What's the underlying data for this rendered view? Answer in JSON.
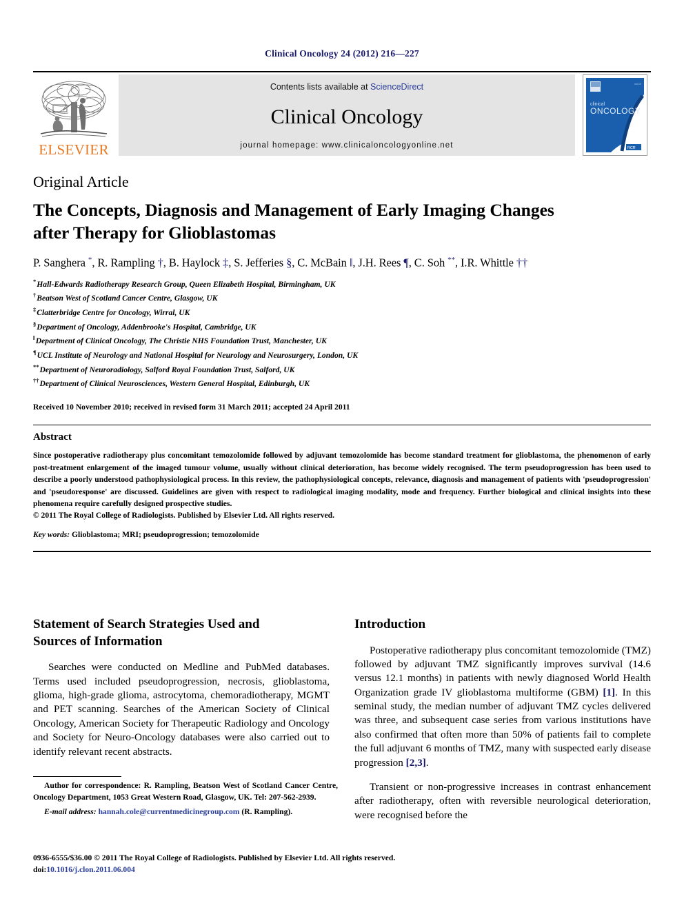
{
  "running_head": "Clinical Oncology 24 (2012) 216—227",
  "masthead": {
    "publisher_name": "ELSEVIER",
    "contents_prefix": "Contents lists available at ",
    "contents_link": "ScienceDirect",
    "journal_name": "Clinical Oncology",
    "homepage": "journal homepage: www.clinicaloncologyonline.net",
    "cover": {
      "line1": "clinical",
      "line2": "ONCOLOGY",
      "badge": "RCR"
    },
    "colors": {
      "elsevier_orange": "#E87722",
      "link_blue": "#2b3f9e",
      "band_grey": "#e4e4e4",
      "cover_blue": "#1a5fae"
    }
  },
  "article": {
    "type": "Original Article",
    "title_line1": "The Concepts, Diagnosis and Management of Early Imaging Changes",
    "title_line2": "after Therapy for Glioblastomas",
    "authors_html": "P. Sanghera <sup>*</sup>, R. Rampling <span class=\"dag\">†</span>, B. Haylock <span class=\"dag\">‡</span>, S. Jefferies <span class=\"dag\">§</span>, C. McBain <span class=\"dag\">‖</span>, J.H. Rees <span class=\"dag\">¶</span>, C. Soh <sup>**</sup>, I.R. Whittle <span class=\"dag\">††</span>",
    "affiliations": [
      {
        "marker": "*",
        "text": "Hall-Edwards Radiotherapy Research Group, Queen Elizabeth Hospital, Birmingham, UK"
      },
      {
        "marker": "†",
        "text": "Beatson West of Scotland Cancer Centre, Glasgow, UK"
      },
      {
        "marker": "‡",
        "text": "Clatterbridge Centre for Oncology, Wirral, UK"
      },
      {
        "marker": "§",
        "text": "Department of Oncology, Addenbrooke's Hospital, Cambridge, UK"
      },
      {
        "marker": "‖",
        "text": "Department of Clinical Oncology, The Christie NHS Foundation Trust, Manchester, UK"
      },
      {
        "marker": "¶",
        "text": "UCL Institute of Neurology and National Hospital for Neurology and Neurosurgery, London, UK"
      },
      {
        "marker": "**",
        "text": "Department of Neuroradiology, Salford Royal Foundation Trust, Salford, UK"
      },
      {
        "marker": "††",
        "text": "Department of Clinical Neurosciences, Western General Hospital, Edinburgh, UK"
      }
    ],
    "history": "Received 10 November 2010; received in revised form 31 March 2011; accepted 24 April 2011"
  },
  "abstract": {
    "heading": "Abstract",
    "body": "Since postoperative radiotherapy plus concomitant temozolomide followed by adjuvant temozolomide has become standard treatment for glioblastoma, the phenomenon of early post-treatment enlargement of the imaged tumour volume, usually without clinical deterioration, has become widely recognised. The term pseudoprogression has been used to describe a poorly understood pathophysiological process. In this review, the pathophysiological concepts, relevance, diagnosis and management of patients with 'pseudoprogression' and 'pseudoresponse' are discussed. Guidelines are given with respect to radiological imaging modality, mode and frequency. Further biological and clinical insights into these phenomena require carefully designed prospective studies.",
    "copyright": "© 2011 The Royal College of Radiologists. Published by Elsevier Ltd. All rights reserved.",
    "keywords_label": "Key words:",
    "keywords_value": " Glioblastoma; MRI; pseudoprogression; temozolomide"
  },
  "body": {
    "left_column": {
      "heading_line1": "Statement of Search Strategies Used and",
      "heading_line2": "Sources of Information",
      "paragraph": "Searches were conducted on Medline and PubMed databases. Terms used included pseudoprogression, necrosis, glioblastoma, glioma, high-grade glioma, astrocytoma, chemoradiotherapy, MGMT and PET scanning. Searches of the American Society of Clinical Oncology, American Society for Therapeutic Radiology and Oncology and Society for Neuro-Oncology databases were also carried out to identify relevant recent abstracts."
    },
    "right_column": {
      "heading": "Introduction",
      "paragraph1_html": "Postoperative radiotherapy plus concomitant temozolomide (TMZ) followed by adjuvant TMZ significantly improves survival (14.6 versus 12.1 months) in patients with newly diagnosed World Health Organization grade IV glioblastoma multiforme (GBM) <span class=\"ref\">[1]</span>. In this seminal study, the median number of adjuvant TMZ cycles delivered was three, and subsequent case series from various institutions have also confirmed that often more than 50% of patients fail to complete the full adjuvant 6 months of TMZ, many with suspected early disease progression <span class=\"ref\">[2,3]</span>.",
      "paragraph2": "Transient or non-progressive increases in contrast enhancement after radiotherapy, often with reversible neurological deterioration, were recognised before the"
    }
  },
  "footnote": {
    "correspondence": "Author for correspondence: R. Rampling, Beatson West of Scotland Cancer Centre, Oncology Department, 1053 Great Western Road, Glasgow, UK. Tel: 207-562-2939.",
    "email_label": "E-mail address:",
    "email_value": "hannah.cole@currentmedicinegroup.com",
    "email_suffix": " (R. Rampling)."
  },
  "bottom": {
    "issn_line": "0936-6555/$36.00 © 2011 The Royal College of Radiologists. Published by Elsevier Ltd. All rights reserved.",
    "doi_label": "doi:",
    "doi_value": "10.1016/j.clon.2011.06.004"
  }
}
